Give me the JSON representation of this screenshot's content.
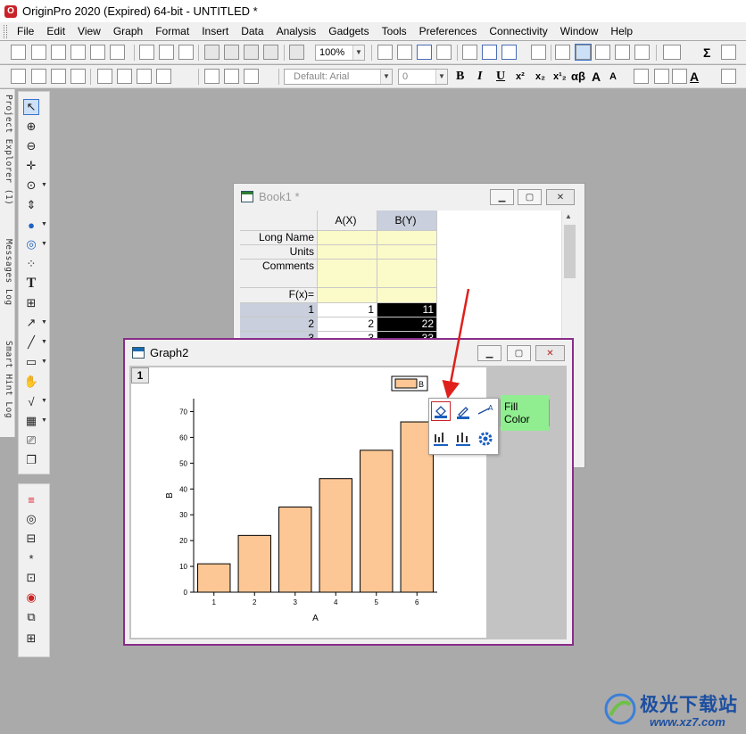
{
  "app": {
    "title": "OriginPro 2020 (Expired) 64-bit - UNTITLED *",
    "icon_letter": "O"
  },
  "menu": [
    "File",
    "Edit",
    "View",
    "Graph",
    "Format",
    "Insert",
    "Data",
    "Analysis",
    "Gadgets",
    "Tools",
    "Preferences",
    "Connectivity",
    "Window",
    "Help"
  ],
  "toolbar": {
    "zoom_value": "100%",
    "font_name": "Default: Arial",
    "font_size": "0",
    "bold_label": "B",
    "italic_label": "I",
    "underline_label": "U",
    "greek_label": "αβ",
    "sigma_label": "Σ",
    "text_tool_label": "T"
  },
  "side_tabs": {
    "project_explorer": "Project Explorer (1)",
    "messages_log": "Messages Log",
    "smart_hint_log": "Smart Hint Log"
  },
  "book": {
    "title": "Book1 *",
    "columns": [
      "A(X)",
      "B(Y)"
    ],
    "row_labels": [
      "Long Name",
      "Units",
      "Comments",
      "F(x)="
    ],
    "rows": [
      {
        "n": "1",
        "a": "1",
        "b": "11"
      },
      {
        "n": "2",
        "a": "2",
        "b": "22"
      },
      {
        "n": "3",
        "a": "3",
        "b": "33"
      }
    ]
  },
  "graph": {
    "title": "Graph2",
    "layer_label": "1",
    "tooltip": "Fill Color"
  },
  "chart_data": {
    "type": "bar",
    "categories": [
      "1",
      "2",
      "3",
      "4",
      "5",
      "6"
    ],
    "series": [
      {
        "name": "B",
        "values": [
          11,
          22,
          33,
          44,
          55,
          66
        ]
      }
    ],
    "xlabel": "A",
    "ylabel": "B",
    "ylim": [
      0,
      75
    ],
    "yticks": [
      0,
      10,
      20,
      30,
      40,
      50,
      60,
      70
    ],
    "bar_color": "#fdc795",
    "grid": false,
    "legend": "top-right"
  },
  "watermark": {
    "name": "极光下载站",
    "url": "www.xz7.com"
  },
  "colors": {
    "accent": "#8a2c8a",
    "arrow": "#e0201c",
    "selected_col": "#c9cfdc",
    "header_yellow": "#fbfac9"
  }
}
